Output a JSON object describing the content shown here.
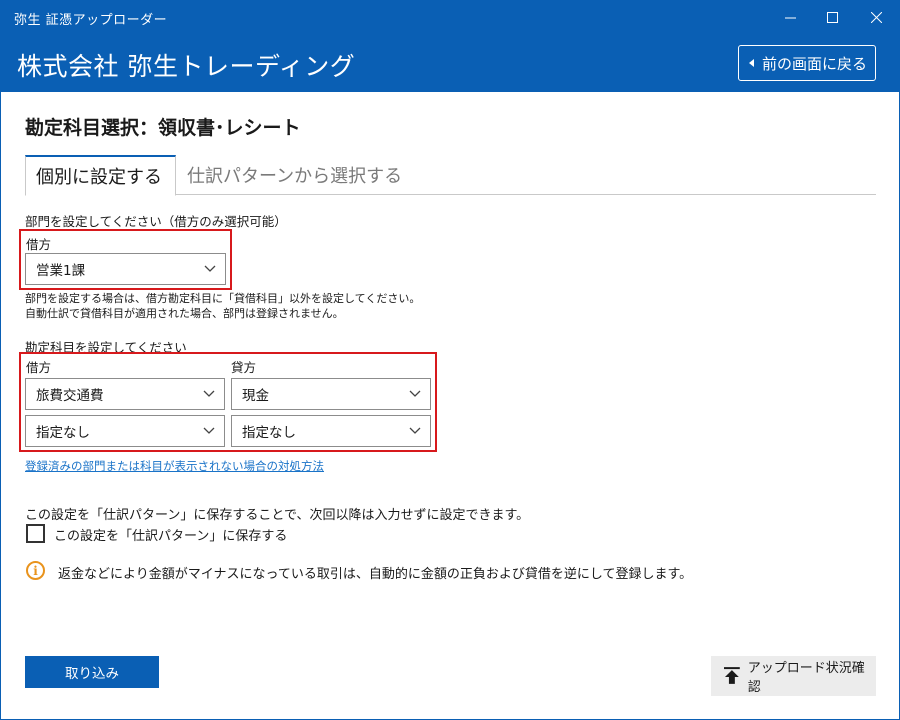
{
  "window": {
    "app_title": "弥生 証憑アップローダー",
    "minimize_icon": "minimize-icon",
    "maximize_icon": "maximize-icon",
    "close_icon": "close-icon"
  },
  "header": {
    "company_name": "株式会社 弥生トレーディング",
    "back_label": "前の画面に戻る"
  },
  "page": {
    "title": "勘定科目選択：領収書･レシート"
  },
  "tabs": [
    {
      "label": "個別に設定する",
      "active": true
    },
    {
      "label": "仕訳パターンから選択する",
      "active": false
    }
  ],
  "department": {
    "section_label": "部門を設定してください（借方のみ選択可能）",
    "debit_label": "借方",
    "debit_value": "営業1課",
    "note_line1": "部門を設定する場合は、借方勘定科目に「貸借科目」以外を設定してください。",
    "note_line2": "自動仕訳で貸借科目が適用された場合、部門は登録されません。"
  },
  "accounts": {
    "section_label": "勘定科目を設定してください",
    "debit_label": "借方",
    "credit_label": "貸方",
    "debit_account": "旅費交通費",
    "credit_account": "現金",
    "debit_sub": "指定なし",
    "credit_sub": "指定なし"
  },
  "help_link": "登録済みの部門または科目が表示されない場合の対処方法",
  "pattern": {
    "description": "この設定を「仕訳パターン」に保存することで、次回以降は入力せずに設定できます。",
    "checkbox_label": "この設定を「仕訳パターン」に保存する",
    "checked": false
  },
  "info": {
    "text": "返金などにより金額がマイナスになっている取引は、自動的に金額の正負および貸借を逆にして登録します。"
  },
  "footer": {
    "import_label": "取り込み",
    "upload_status_label": "アップロード状況確認"
  },
  "colors": {
    "brand_blue": "#0a5fb4",
    "highlight_red": "#d7191c",
    "link_blue": "#1a73c8",
    "info_orange": "#e9931c"
  }
}
